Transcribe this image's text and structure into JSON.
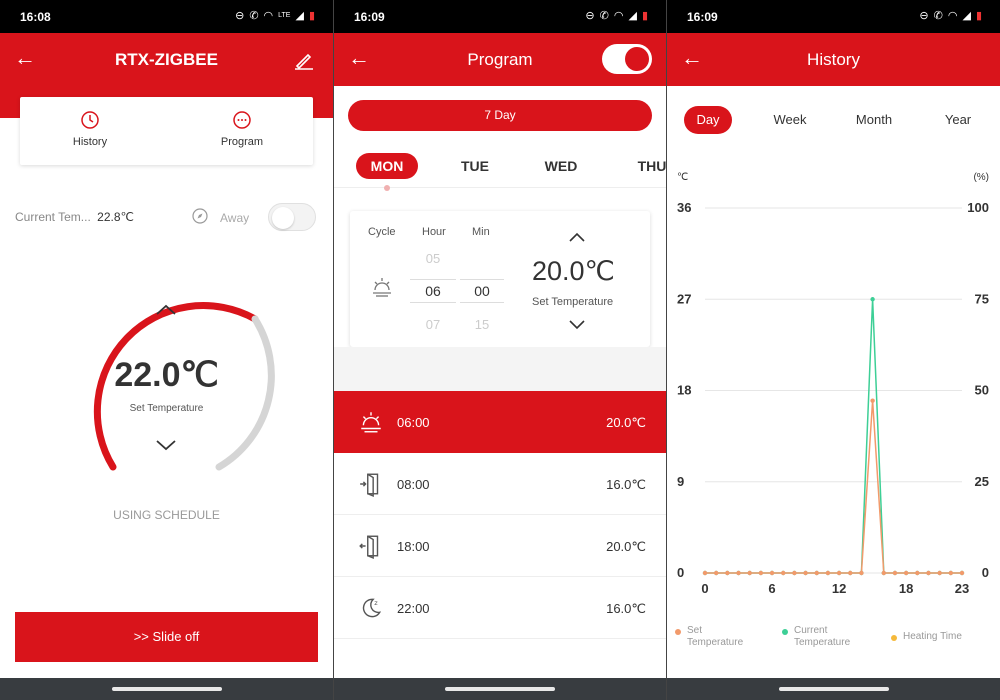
{
  "colors": {
    "accent": "#d9141b",
    "set_temp_line": "#f29a6b",
    "current_temp_line": "#3dcf96",
    "heating_time": "#f5b93a"
  },
  "status": {
    "time1": "16:08",
    "time2": "16:09",
    "time3": "16:09",
    "lte": "LTE"
  },
  "home": {
    "title": "RTX-ZIGBEE",
    "history_label": "History",
    "program_label": "Program",
    "current_temp_label": "Current Tem...",
    "current_temp_value": "22.8℃",
    "away_label": "Away",
    "away_enabled": false,
    "set_temperature": "22.0℃",
    "set_temperature_label": "Set Temperature",
    "mode_text": "USING SCHEDULE",
    "slide_off_label": ">>  Slide off"
  },
  "program": {
    "title": "Program",
    "enabled": true,
    "mode_label": "7 Day",
    "days": [
      "MON",
      "TUE",
      "WED",
      "THU"
    ],
    "selected_day": "MON",
    "editor": {
      "cycle_label": "Cycle",
      "hour_label": "Hour",
      "min_label": "Min",
      "hour_prev": "05",
      "hour_value": "06",
      "hour_next": "07",
      "min_prev": "",
      "min_value": "00",
      "min_next": "15",
      "temperature": "20.0℃",
      "temperature_label": "Set Temperature"
    },
    "rows": [
      {
        "icon": "sunrise-icon",
        "time": "06:00",
        "temp": "20.0℃",
        "active": true
      },
      {
        "icon": "door-exit-icon",
        "time": "08:00",
        "temp": "16.0℃",
        "active": false
      },
      {
        "icon": "door-enter-icon",
        "time": "18:00",
        "temp": "20.0℃",
        "active": false
      },
      {
        "icon": "moon-icon",
        "time": "22:00",
        "temp": "16.0℃",
        "active": false
      }
    ]
  },
  "history": {
    "title": "History",
    "periods": [
      "Day",
      "Week",
      "Month",
      "Year"
    ],
    "selected_period": "Day",
    "chart_data": {
      "type": "line",
      "x": [
        0,
        1,
        2,
        3,
        4,
        5,
        6,
        7,
        8,
        9,
        10,
        11,
        12,
        13,
        14,
        15,
        16,
        17,
        18,
        19,
        20,
        21,
        22,
        23
      ],
      "x_ticks": [
        0,
        6,
        12,
        18,
        23
      ],
      "ylabel_left": "℃",
      "ylabel_right": "(%)",
      "y_left_ticks": [
        0,
        9,
        18,
        27,
        36
      ],
      "y_right_ticks": [
        0,
        25,
        50,
        75,
        100
      ],
      "ylim_left": [
        0,
        36
      ],
      "ylim_right": [
        0,
        100
      ],
      "grid": true,
      "series": [
        {
          "name": "Set Temperature",
          "axis": "left",
          "values": [
            0,
            0,
            0,
            0,
            0,
            0,
            0,
            0,
            0,
            0,
            0,
            0,
            0,
            0,
            0,
            17,
            0,
            0,
            0,
            0,
            0,
            0,
            0,
            0
          ]
        },
        {
          "name": "Current Temperature",
          "axis": "left",
          "values": [
            0,
            0,
            0,
            0,
            0,
            0,
            0,
            0,
            0,
            0,
            0,
            0,
            0,
            0,
            0,
            27,
            0,
            0,
            0,
            0,
            0,
            0,
            0,
            0
          ]
        },
        {
          "name": "Heating Time",
          "axis": "right",
          "values": []
        }
      ],
      "legend_position": "bottom"
    },
    "legend": {
      "set_line1": "Set",
      "set_line2": "Temperature",
      "cur_line1": "Current",
      "cur_line2": "Temperature",
      "heat": "Heating Time"
    }
  }
}
